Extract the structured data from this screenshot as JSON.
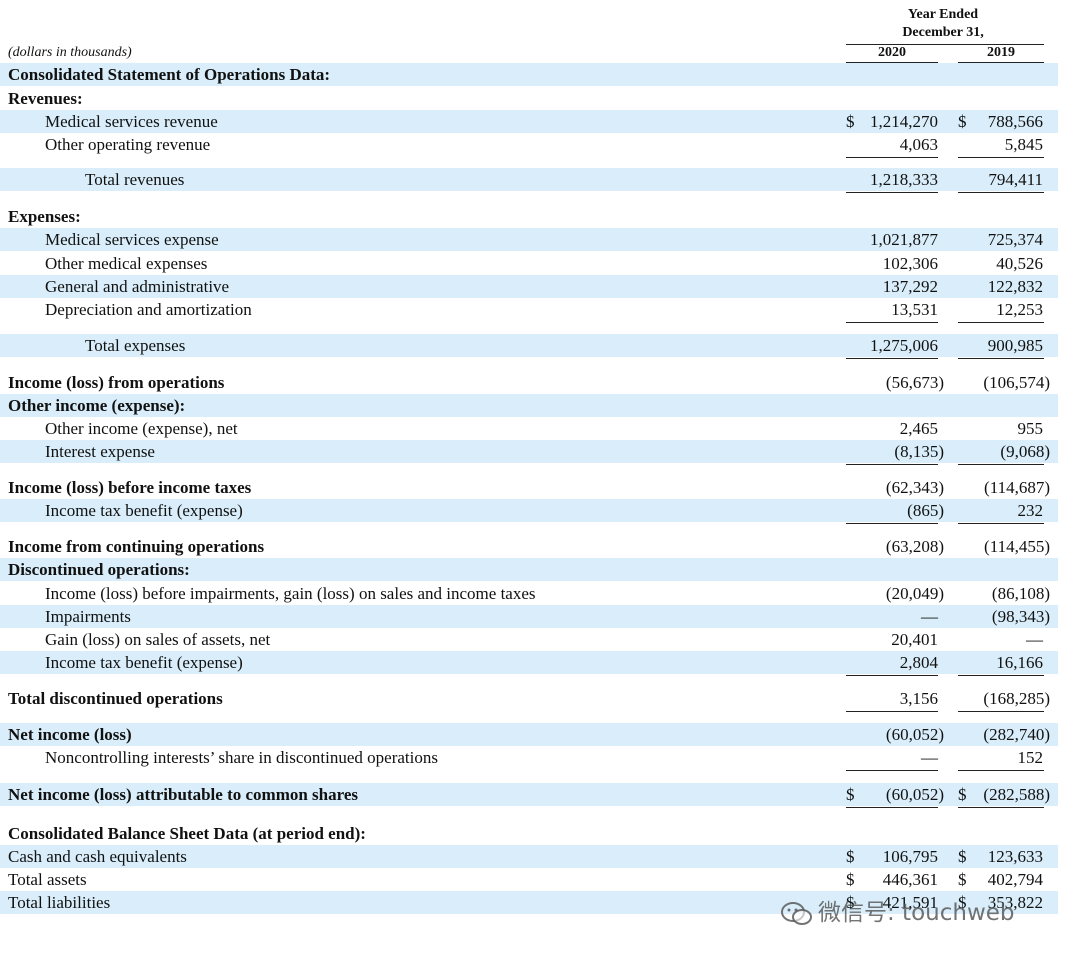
{
  "header": {
    "period_line1": "Year Ended",
    "period_line2": "December 31,",
    "col1": "2020",
    "col2": "2019",
    "units": "(dollars in thousands)"
  },
  "rows": [
    {
      "label": "Consolidated Statement of Operations Data:",
      "bold": true,
      "indent": 0,
      "shade": true,
      "v2020": "",
      "v2019": ""
    },
    {
      "label": "Revenues:",
      "bold": true,
      "indent": 0,
      "shade": false,
      "v2020": "",
      "v2019": ""
    },
    {
      "label": "Medical services revenue",
      "bold": false,
      "indent": 1,
      "shade": true,
      "dollar2020": "$",
      "v2020": "1,214,270",
      "dollar2019": "$",
      "v2019": "788,566"
    },
    {
      "label": "Other operating revenue",
      "bold": false,
      "indent": 1,
      "shade": false,
      "v2020": "4,063",
      "v2019": "5,845",
      "ul": true
    },
    {
      "label": "Total revenues",
      "bold": false,
      "indent": 2,
      "shade": true,
      "v2020": "1,218,333",
      "v2019": "794,411",
      "ul": true
    },
    {
      "label": "Expenses:",
      "bold": true,
      "indent": 0,
      "shade": false,
      "v2020": "",
      "v2019": ""
    },
    {
      "label": "Medical services expense",
      "bold": false,
      "indent": 1,
      "shade": true,
      "v2020": "1,021,877",
      "v2019": "725,374"
    },
    {
      "label": "Other medical expenses",
      "bold": false,
      "indent": 1,
      "shade": false,
      "v2020": "102,306",
      "v2019": "40,526"
    },
    {
      "label": "General and administrative",
      "bold": false,
      "indent": 1,
      "shade": true,
      "v2020": "137,292",
      "v2019": "122,832"
    },
    {
      "label": "Depreciation and amortization",
      "bold": false,
      "indent": 1,
      "shade": false,
      "v2020": "13,531",
      "v2019": "12,253",
      "ul": true
    },
    {
      "label": "Total expenses",
      "bold": false,
      "indent": 2,
      "shade": true,
      "v2020": "1,275,006",
      "v2019": "900,985",
      "ul": true
    },
    {
      "label": "Income (loss) from operations",
      "bold": true,
      "indent": 0,
      "shade": false,
      "v2020": "(56,673)",
      "v2019": "(106,574)"
    },
    {
      "label": "Other income (expense):",
      "bold": true,
      "indent": 0,
      "shade": true,
      "v2020": "",
      "v2019": ""
    },
    {
      "label": "Other income (expense), net",
      "bold": false,
      "indent": 1,
      "shade": false,
      "v2020": "2,465",
      "v2019": "955"
    },
    {
      "label": "Interest expense",
      "bold": false,
      "indent": 1,
      "shade": true,
      "v2020": "(8,135)",
      "v2019": "(9,068)",
      "ul": true
    },
    {
      "label": "Income (loss) before income taxes",
      "bold": true,
      "indent": 0,
      "shade": false,
      "v2020": "(62,343)",
      "v2019": "(114,687)"
    },
    {
      "label": "Income tax benefit (expense)",
      "bold": false,
      "indent": 1,
      "shade": true,
      "v2020": "(865)",
      "v2019": "232",
      "ul": true
    },
    {
      "label": "Income from continuing operations",
      "bold": true,
      "indent": 0,
      "shade": false,
      "v2020": "(63,208)",
      "v2019": "(114,455)"
    },
    {
      "label": "Discontinued operations:",
      "bold": true,
      "indent": 0,
      "shade": true,
      "v2020": "",
      "v2019": ""
    },
    {
      "label": "Income (loss) before impairments, gain (loss) on sales and income taxes",
      "bold": false,
      "indent": 1,
      "shade": false,
      "v2020": "(20,049)",
      "v2019": "(86,108)"
    },
    {
      "label": "Impairments",
      "bold": false,
      "indent": 1,
      "shade": true,
      "v2020": "—",
      "v2019": "(98,343)"
    },
    {
      "label": "Gain (loss) on sales of assets, net",
      "bold": false,
      "indent": 1,
      "shade": false,
      "v2020": "20,401",
      "v2019": "—"
    },
    {
      "label": "Income tax benefit (expense)",
      "bold": false,
      "indent": 1,
      "shade": true,
      "v2020": "2,804",
      "v2019": "16,166",
      "ul": true
    },
    {
      "label": "Total discontinued operations",
      "bold": true,
      "indent": 0,
      "shade": false,
      "v2020": "3,156",
      "v2019": "(168,285)",
      "ul": true
    },
    {
      "label": "Net income (loss)",
      "bold": true,
      "indent": 0,
      "shade": true,
      "v2020": "(60,052)",
      "v2019": "(282,740)"
    },
    {
      "label": "Noncontrolling interests’ share in discontinued operations",
      "bold": false,
      "indent": 1,
      "shade": false,
      "v2020": "—",
      "v2019": "152",
      "ul": true
    },
    {
      "label": "Net income (loss) attributable to common shares",
      "bold": true,
      "indent": 0,
      "shade": true,
      "dollar2020": "$",
      "v2020": "(60,052)",
      "dollar2019": "$",
      "v2019": "(282,588)",
      "ul": true
    },
    {
      "label": "Consolidated Balance Sheet Data (at period end):",
      "bold": true,
      "indent": 0,
      "shade": false,
      "v2020": "",
      "v2019": ""
    },
    {
      "label": "Cash and cash equivalents",
      "bold": false,
      "indent": 0,
      "shade": true,
      "dollar2020": "$",
      "v2020": "106,795",
      "dollar2019": "$",
      "v2019": "123,633"
    },
    {
      "label": "Total assets",
      "bold": false,
      "indent": 0,
      "shade": false,
      "dollar2020": "$",
      "v2020": "446,361",
      "dollar2019": "$",
      "v2019": "402,794"
    },
    {
      "label": "Total liabilities",
      "bold": false,
      "indent": 0,
      "shade": true,
      "dollar2020": "$",
      "v2020": "421,591",
      "dollar2019": "$",
      "v2019": "353,822"
    }
  ],
  "watermark": {
    "text": "微信号: touchweb",
    "icon": "wechat-icon"
  },
  "colors": {
    "shade": "#d9eefa",
    "text": "#111111"
  }
}
